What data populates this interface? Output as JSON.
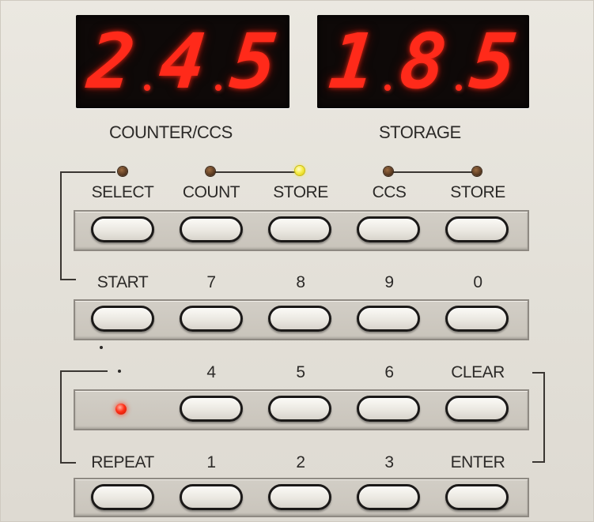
{
  "displays": {
    "counter": {
      "digits": [
        "2",
        "4",
        "5"
      ],
      "label": "COUNTER/CCS"
    },
    "storage": {
      "digits": [
        "1",
        "8",
        "5"
      ],
      "label": "STORAGE"
    }
  },
  "colors": {
    "led_display": "#ff2a1a",
    "indicator_off": "#5a3a22",
    "indicator_store_on": "#f7ee4a",
    "indicator_red_on": "#ff3018",
    "panel": "#e6e3dc"
  },
  "row1": {
    "labels": [
      "SELECT",
      "COUNT",
      "STORE",
      "CCS",
      "STORE"
    ],
    "indicators": [
      "off",
      "off",
      "on-yellow",
      "off",
      "off"
    ]
  },
  "row2": {
    "labels": [
      "START",
      "7",
      "8",
      "9",
      "0"
    ]
  },
  "row3": {
    "labels": [
      "",
      "4",
      "5",
      "6",
      "CLEAR"
    ],
    "status_indicator": "on-red"
  },
  "row4": {
    "labels": [
      "REPEAT",
      "1",
      "2",
      "3",
      "ENTER"
    ]
  }
}
